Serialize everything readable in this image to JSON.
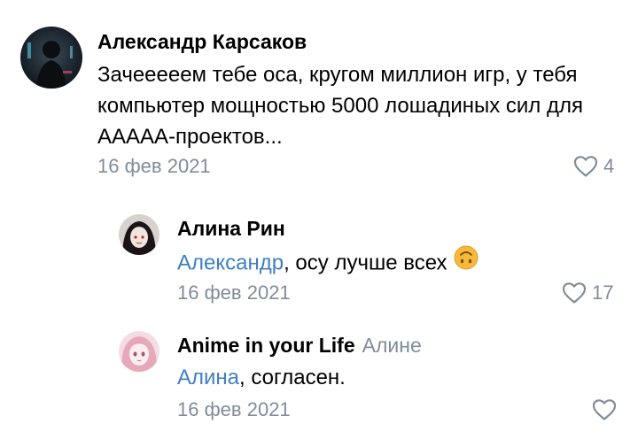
{
  "comments": [
    {
      "author": "Александр Карсаков",
      "text": "Зачеееeeм тебе оса, кругом миллион игр, у тебя компьютер мощностью 5000 лошадиных сил для ААААА-проектов...",
      "date": "16 фев 2021",
      "likes": "4"
    },
    {
      "author": "Алина Рин",
      "mention": "Александр",
      "text": ", осу лучше всех",
      "emoji": "upside-down-face-icon",
      "date": "16 фев 2021",
      "likes": "17"
    },
    {
      "author": "Anime in your Life",
      "reply_to": "Алине",
      "mention": "Алина",
      "text": ", согласен.",
      "date": "16 фев 2021",
      "likes": ""
    }
  ],
  "colors": {
    "secondary": "#818c99",
    "mention": "#3f7fc4",
    "emoji": "#f7b93a"
  }
}
